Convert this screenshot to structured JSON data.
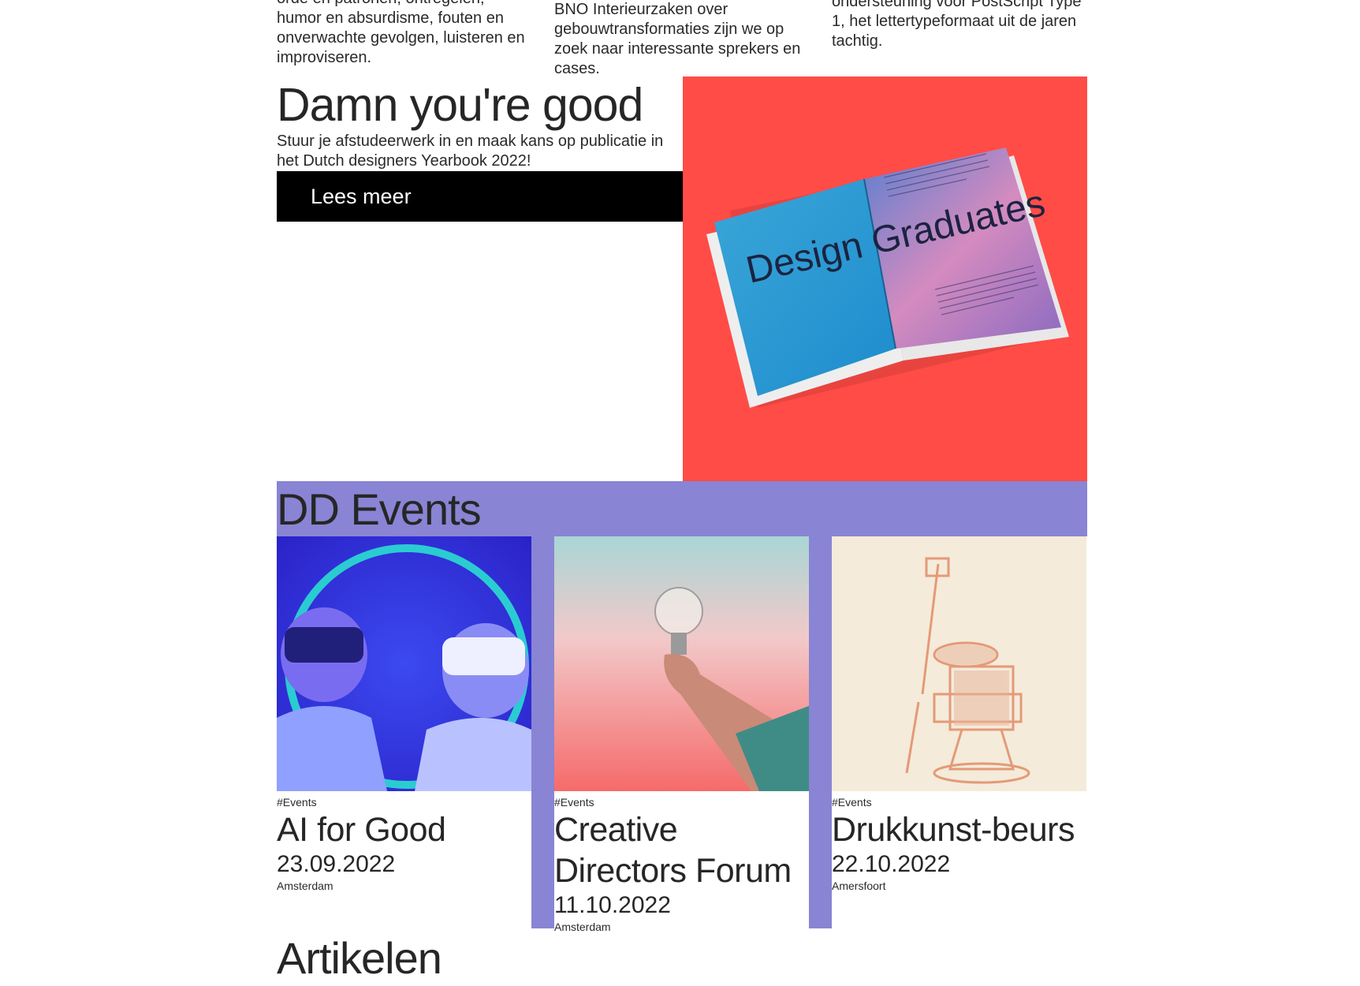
{
  "teasers": [
    "orde en patronen, ontregelen, humor en absurdisme, fouten en onverwachte gevolgen, luisteren en improviseren.",
    "BNO Interieurzaken over gebouwtransformaties zijn we op zoek naar interessante sprekers en cases.",
    "ondersteuning voor PostScript Type 1, het lettertypeformaat uit de jaren tachtig."
  ],
  "hero": {
    "title": "Damn you're good",
    "subtitle": "Stuur je afstudeerwerk in en maak kans op publicatie in het Dutch designers Yearbook 2022!",
    "button_label": "Lees meer",
    "image_text": "Design Graduates",
    "background_color": "#ff4c47"
  },
  "events": {
    "title": "DD Events",
    "accent_color": "#8984d4",
    "items": [
      {
        "tag": "#Events",
        "title": "AI for Good",
        "date": "23.09.2022",
        "location": "Amsterdam"
      },
      {
        "tag": "#Events",
        "title": "Creative Directors Forum",
        "date": "11.10.2022",
        "location": "Amsterdam"
      },
      {
        "tag": "#Events",
        "title": "Drukkunst-beurs",
        "date": "22.10.2022",
        "location": "Amersfoort"
      }
    ]
  },
  "articles": {
    "title": "Artikelen"
  }
}
